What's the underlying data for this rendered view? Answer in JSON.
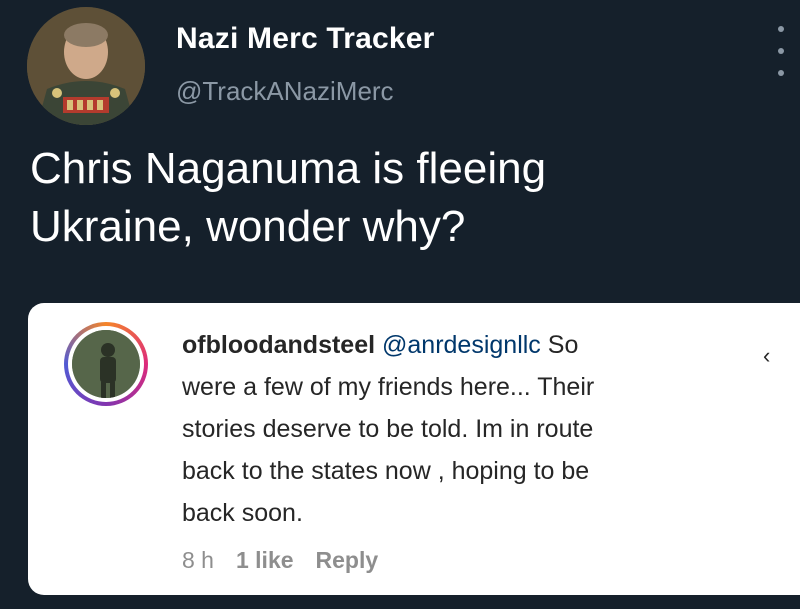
{
  "tweet": {
    "author_name": "Nazi Merc Tracker",
    "author_handle": "@TrackANaziMerc",
    "text_line1": "Chris Naganuma is fleeing",
    "text_line2": "Ukraine, wonder why?",
    "avatar_icon": "profile-photo-icon",
    "more_icon": "more-vertical-icon"
  },
  "embedded_comment": {
    "username": "ofbloodandsteel",
    "mention": "@anrdesignllc",
    "line1_rest": "So",
    "line2": "were a few of my friends here... Their",
    "line3": "stories deserve to be told. Im in route",
    "line4": "back to the states now , hoping to be",
    "line5": "back soon.",
    "time": "8 h",
    "likes": "1 like",
    "reply": "Reply",
    "chevron_glyph": "‹",
    "avatar_icon": "instagram-avatar-icon"
  },
  "colors": {
    "background": "#15202b",
    "card": "#ffffff",
    "muted": "#8b98a5"
  }
}
